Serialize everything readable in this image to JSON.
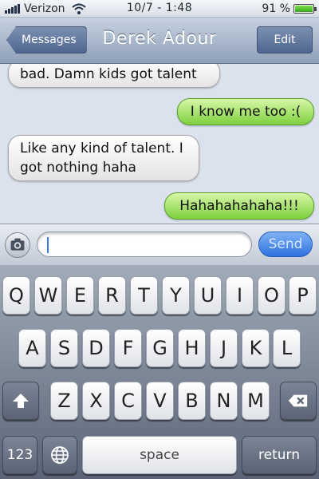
{
  "status_bar": {
    "carrier": "Verizon",
    "time": "10/7 - 1:48",
    "battery": "91 %"
  },
  "nav": {
    "back_label": "Messages",
    "title": "Derek Adour",
    "edit_label": "Edit"
  },
  "messages": [
    {
      "text": "bad. Damn kids got talent",
      "from": "received"
    },
    {
      "text": "I know me too :(",
      "from": "sent"
    },
    {
      "text": "Like any kind of talent. I got nothing haha",
      "from": "received"
    },
    {
      "text": "Hahahahahaha!!!",
      "from": "sent"
    }
  ],
  "composer": {
    "input_value": "",
    "send_label": "Send"
  },
  "keyboard": {
    "row1": [
      "Q",
      "W",
      "E",
      "R",
      "T",
      "Y",
      "U",
      "I",
      "O",
      "P"
    ],
    "row2": [
      "A",
      "S",
      "D",
      "F",
      "G",
      "H",
      "J",
      "K",
      "L"
    ],
    "row3": [
      "Z",
      "X",
      "C",
      "V",
      "B",
      "N",
      "M"
    ],
    "numbers_label": "123",
    "space_label": "space",
    "return_label": "return"
  },
  "colors": {
    "sent_bubble": "#86d44a",
    "received_bubble": "#f2f2f2",
    "send_button": "#2e72e0",
    "nav_bar": "#8e9fb8"
  },
  "icons": {
    "camera": "camera-icon",
    "shift": "shift-icon",
    "delete": "delete-icon",
    "globe": "globe-icon",
    "wifi": "wifi-icon",
    "battery": "battery-icon",
    "signal": "signal-icon"
  }
}
